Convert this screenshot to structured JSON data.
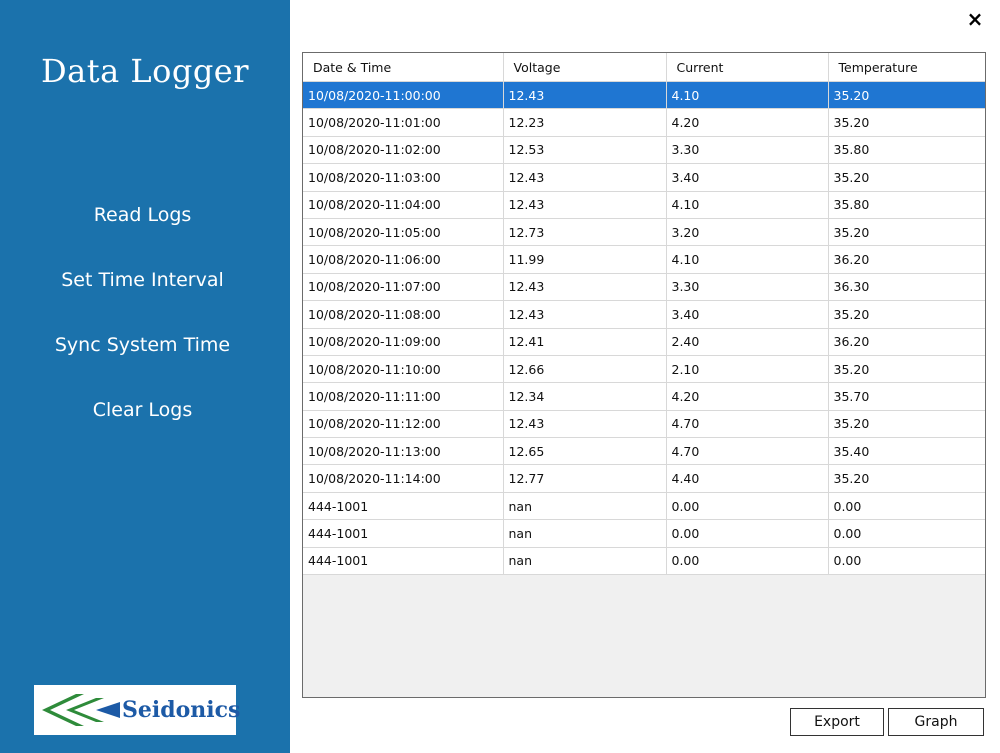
{
  "app": {
    "title": "Data Logger",
    "close_glyph": "×"
  },
  "sidebar": {
    "menu": [
      {
        "label": "Read Logs"
      },
      {
        "label": "Set Time Interval"
      },
      {
        "label": "Sync System Time"
      },
      {
        "label": "Clear Logs"
      }
    ],
    "logo_text": "Seidonics"
  },
  "table": {
    "columns": [
      "Date & Time",
      "Voltage",
      "Current",
      "Temperature"
    ],
    "selected_row": 0,
    "rows": [
      [
        "10/08/2020-11:00:00",
        "12.43",
        "4.10",
        "35.20"
      ],
      [
        "10/08/2020-11:01:00",
        "12.23",
        "4.20",
        "35.20"
      ],
      [
        "10/08/2020-11:02:00",
        "12.53",
        "3.30",
        "35.80"
      ],
      [
        "10/08/2020-11:03:00",
        "12.43",
        "3.40",
        "35.20"
      ],
      [
        "10/08/2020-11:04:00",
        "12.43",
        "4.10",
        "35.80"
      ],
      [
        "10/08/2020-11:05:00",
        "12.73",
        "3.20",
        "35.20"
      ],
      [
        "10/08/2020-11:06:00",
        "11.99",
        "4.10",
        "36.20"
      ],
      [
        "10/08/2020-11:07:00",
        "12.43",
        "3.30",
        "36.30"
      ],
      [
        "10/08/2020-11:08:00",
        "12.43",
        "3.40",
        "35.20"
      ],
      [
        "10/08/2020-11:09:00",
        "12.41",
        "2.40",
        "36.20"
      ],
      [
        "10/08/2020-11:10:00",
        "12.66",
        "2.10",
        "35.20"
      ],
      [
        "10/08/2020-11:11:00",
        "12.34",
        "4.20",
        "35.70"
      ],
      [
        "10/08/2020-11:12:00",
        "12.43",
        "4.70",
        "35.20"
      ],
      [
        "10/08/2020-11:13:00",
        "12.65",
        "4.70",
        "35.40"
      ],
      [
        "10/08/2020-11:14:00",
        "12.77",
        "4.40",
        "35.20"
      ],
      [
        "444-1001",
        "nan",
        "0.00",
        "0.00"
      ],
      [
        "444-1001",
        "nan",
        "0.00",
        "0.00"
      ],
      [
        "444-1001",
        "nan",
        "0.00",
        "0.00"
      ]
    ]
  },
  "buttons": {
    "export_label": "Export",
    "graph_label": "Graph"
  },
  "colors": {
    "sidebar_bg": "#1b72ac",
    "selection": "#1f76d2",
    "logo_text": "#1d5aa6",
    "logo_mark": "#2e8b3a"
  }
}
